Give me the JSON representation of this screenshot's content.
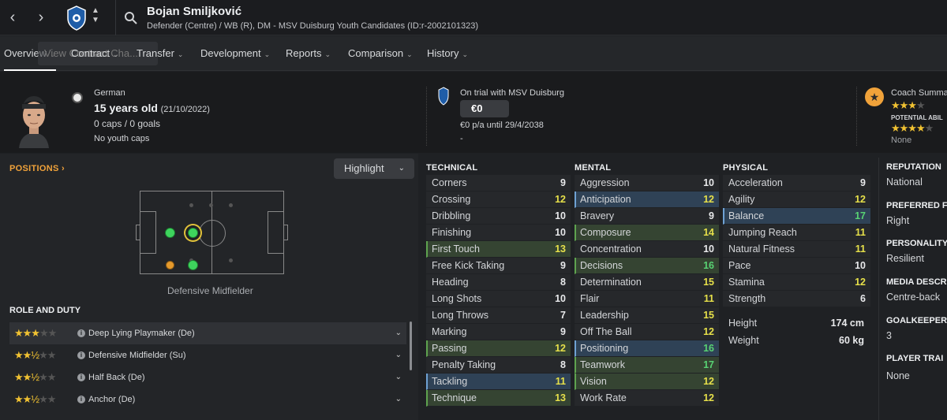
{
  "header": {
    "name": "Bojan Smiljković",
    "subtitle": "Defender (Centre) / WB (R), DM - MSV Duisburg Youth Candidates (ID:r-2002101323)"
  },
  "tabs": [
    {
      "label": "Overview"
    },
    {
      "label": "Contract"
    },
    {
      "label": "Transfer"
    },
    {
      "label": "Development"
    },
    {
      "label": "Reports"
    },
    {
      "label": "Comparison"
    },
    {
      "label": "History"
    }
  ],
  "ghost_overlay": "View Contract Cha...",
  "profile": {
    "nationality": "German",
    "age": "15 years old",
    "dob": "(21/10/2022)",
    "caps": "0 caps / 0 goals",
    "youth_caps": "No youth caps"
  },
  "contract": {
    "status": "On trial with MSV Duisburg",
    "wage": "€0",
    "terms": "€0 p/a until 29/4/2038",
    "extra": "-"
  },
  "coach": {
    "title": "Coach Summa",
    "current_stars": 3,
    "potential_label": "POTENTIAL ABIL",
    "potential_stars": 4,
    "none_label": "None"
  },
  "positions": {
    "title": "POSITIONS",
    "highlight_label": "Highlight",
    "selected_position": "Defensive Midfielder"
  },
  "roles": {
    "title": "ROLE AND DUTY",
    "items": [
      {
        "label": "Deep Lying Playmaker (De)",
        "stars": 3
      },
      {
        "label": "Defensive Midfielder (Su)",
        "stars": 2.5
      },
      {
        "label": "Half Back (De)",
        "stars": 2.5
      },
      {
        "label": "Anchor (De)",
        "stars": 2.5
      }
    ]
  },
  "technical": {
    "title": "TECHNICAL",
    "items": [
      {
        "name": "Corners",
        "value": "9",
        "hl": ""
      },
      {
        "name": "Crossing",
        "value": "12",
        "hl": ""
      },
      {
        "name": "Dribbling",
        "value": "10",
        "hl": ""
      },
      {
        "name": "Finishing",
        "value": "10",
        "hl": ""
      },
      {
        "name": "First Touch",
        "value": "13",
        "hl": "green"
      },
      {
        "name": "Free Kick Taking",
        "value": "9",
        "hl": ""
      },
      {
        "name": "Heading",
        "value": "8",
        "hl": ""
      },
      {
        "name": "Long Shots",
        "value": "10",
        "hl": ""
      },
      {
        "name": "Long Throws",
        "value": "7",
        "hl": ""
      },
      {
        "name": "Marking",
        "value": "9",
        "hl": ""
      },
      {
        "name": "Passing",
        "value": "12",
        "hl": "green"
      },
      {
        "name": "Penalty Taking",
        "value": "8",
        "hl": ""
      },
      {
        "name": "Tackling",
        "value": "11",
        "hl": "blue"
      },
      {
        "name": "Technique",
        "value": "13",
        "hl": "green"
      }
    ]
  },
  "mental": {
    "title": "MENTAL",
    "items": [
      {
        "name": "Aggression",
        "value": "10",
        "hl": ""
      },
      {
        "name": "Anticipation",
        "value": "12",
        "hl": "blue"
      },
      {
        "name": "Bravery",
        "value": "9",
        "hl": ""
      },
      {
        "name": "Composure",
        "value": "14",
        "hl": "green"
      },
      {
        "name": "Concentration",
        "value": "10",
        "hl": ""
      },
      {
        "name": "Decisions",
        "value": "16",
        "hl": "green"
      },
      {
        "name": "Determination",
        "value": "15",
        "hl": ""
      },
      {
        "name": "Flair",
        "value": "11",
        "hl": ""
      },
      {
        "name": "Leadership",
        "value": "15",
        "hl": ""
      },
      {
        "name": "Off The Ball",
        "value": "12",
        "hl": ""
      },
      {
        "name": "Positioning",
        "value": "16",
        "hl": "blue"
      },
      {
        "name": "Teamwork",
        "value": "17",
        "hl": "green"
      },
      {
        "name": "Vision",
        "value": "12",
        "hl": "green"
      },
      {
        "name": "Work Rate",
        "value": "12",
        "hl": ""
      }
    ]
  },
  "physical": {
    "title": "PHYSICAL",
    "items": [
      {
        "name": "Acceleration",
        "value": "9",
        "hl": ""
      },
      {
        "name": "Agility",
        "value": "12",
        "hl": ""
      },
      {
        "name": "Balance",
        "value": "17",
        "hl": "blue"
      },
      {
        "name": "Jumping Reach",
        "value": "11",
        "hl": ""
      },
      {
        "name": "Natural Fitness",
        "value": "11",
        "hl": ""
      },
      {
        "name": "Pace",
        "value": "10",
        "hl": ""
      },
      {
        "name": "Stamina",
        "value": "12",
        "hl": ""
      },
      {
        "name": "Strength",
        "value": "6",
        "hl": ""
      }
    ],
    "height_label": "Height",
    "height_value": "174 cm",
    "weight_label": "Weight",
    "weight_value": "60 kg"
  },
  "info": [
    {
      "label": "REPUTATION",
      "value": "National"
    },
    {
      "label": "PREFERRED F",
      "value": "Right"
    },
    {
      "label": "PERSONALITY",
      "value": "Resilient"
    },
    {
      "label": "MEDIA DESCR",
      "value": "Centre-back"
    },
    {
      "label": "GOALKEEPER",
      "value": "3"
    },
    {
      "label": "PLAYER TRAI",
      "value": "None"
    }
  ],
  "colors": {
    "accent_orange": "#f0a23a",
    "value_yellow": "#e6e04a",
    "value_green": "#58d273",
    "highlight_green": "#5ea34f",
    "highlight_blue": "#6fa2d4"
  }
}
